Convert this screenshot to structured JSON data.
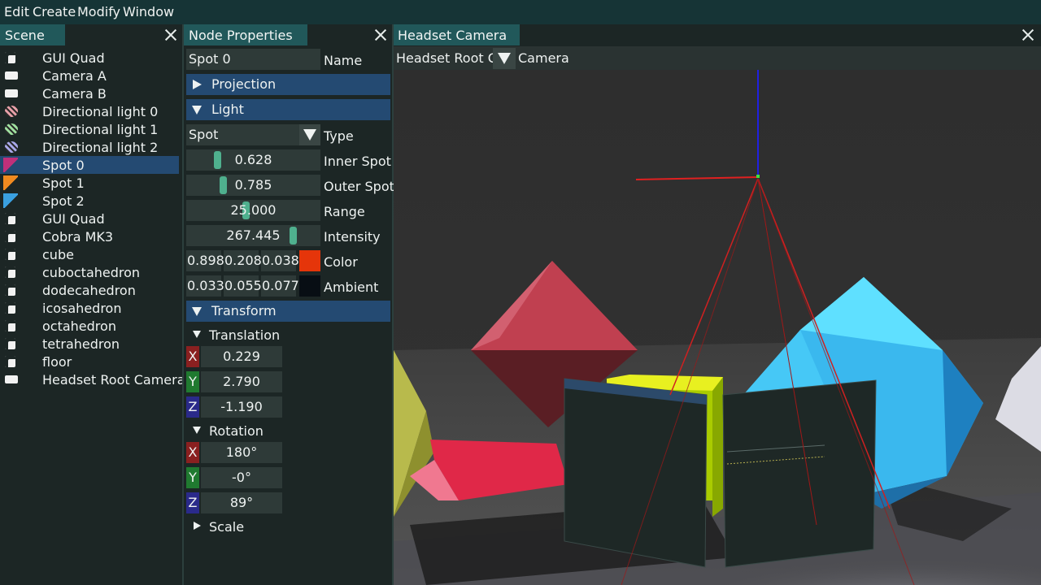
{
  "menu": [
    "Edit",
    "Create",
    "Modify",
    "Window"
  ],
  "scene_panel": {
    "title": "Scene",
    "items": [
      {
        "label": "GUI Quad",
        "icon": "gui-quad-icon"
      },
      {
        "label": "Camera A",
        "icon": "camera-icon"
      },
      {
        "label": "Camera B",
        "icon": "camera-icon"
      },
      {
        "label": "Directional light 0",
        "icon": "directional-light-icon"
      },
      {
        "label": "Directional light 1",
        "icon": "directional-light-icon"
      },
      {
        "label": "Directional light 2",
        "icon": "directional-light-icon"
      },
      {
        "label": "Spot 0",
        "icon": "spot-light-icon",
        "selected": true
      },
      {
        "label": "Spot 1",
        "icon": "spot-light-icon"
      },
      {
        "label": "Spot 2",
        "icon": "spot-light-icon"
      },
      {
        "label": "GUI Quad",
        "icon": "gui-quad-icon"
      },
      {
        "label": "Cobra MK3",
        "icon": "mesh-icon"
      },
      {
        "label": "cube",
        "icon": "mesh-icon"
      },
      {
        "label": "cuboctahedron",
        "icon": "mesh-icon"
      },
      {
        "label": "dodecahedron",
        "icon": "mesh-icon"
      },
      {
        "label": "icosahedron",
        "icon": "mesh-icon"
      },
      {
        "label": "octahedron",
        "icon": "mesh-icon"
      },
      {
        "label": "tetrahedron",
        "icon": "mesh-icon"
      },
      {
        "label": "floor",
        "icon": "mesh-icon"
      },
      {
        "label": "Headset Root Camera",
        "icon": "camera-icon"
      }
    ],
    "icon_colors": [
      "#f2f2f2",
      "#f2f2f2",
      "#f2f2f2",
      "#e8a0a8",
      "#9fe0a0",
      "#a8a8e8",
      "#c0307a",
      "#f08a20",
      "#3aa0e0",
      "#f2f2f2",
      "#f2f2f2",
      "#f2f2f2",
      "#f2f2f2",
      "#f2f2f2",
      "#f2f2f2",
      "#f2f2f2",
      "#f2f2f2",
      "#f2f2f2",
      "#f2f2f2"
    ]
  },
  "properties": {
    "title": "Node Properties",
    "name_value": "Spot 0",
    "name_label": "Name",
    "projection_header": "Projection",
    "light_header": "Light",
    "type_value": "Spot",
    "type_label": "Type",
    "inner_spot": {
      "value": "0.628",
      "label": "Inner Spot",
      "grab_fraction": 0.2
    },
    "outer_spot": {
      "value": "0.785",
      "label": "Outer Spot",
      "grab_fraction": 0.25
    },
    "range": {
      "value": "25.000",
      "label": "Range",
      "grab_fraction": 0.44
    },
    "intensity": {
      "value": "267.445",
      "label": "Intensity",
      "grab_fraction": 0.83
    },
    "color": {
      "r": "0.898",
      "g": "0.208",
      "b": "0.038",
      "label": "Color",
      "swatch": "#e5350a"
    },
    "ambient": {
      "r": "0.033",
      "g": "0.055",
      "b": "0.077",
      "label": "Ambient",
      "swatch": "#080e14"
    },
    "transform_header": "Transform",
    "translation": {
      "label": "Translation",
      "x": "0.229",
      "y": "2.790",
      "z": "-1.190"
    },
    "rotation": {
      "label": "Rotation",
      "x": "180°",
      "y": "-0°",
      "z": "89°"
    },
    "scale_label": "Scale",
    "axis": {
      "x": "X",
      "y": "Y",
      "z": "Z"
    },
    "axis_colors": {
      "x": "#8a2020",
      "y": "#207a30",
      "z": "#2a2a8a"
    }
  },
  "viewport": {
    "title": "Headset Camera",
    "camera_select": "Headset Root Ca",
    "camera_label": "Camera"
  }
}
